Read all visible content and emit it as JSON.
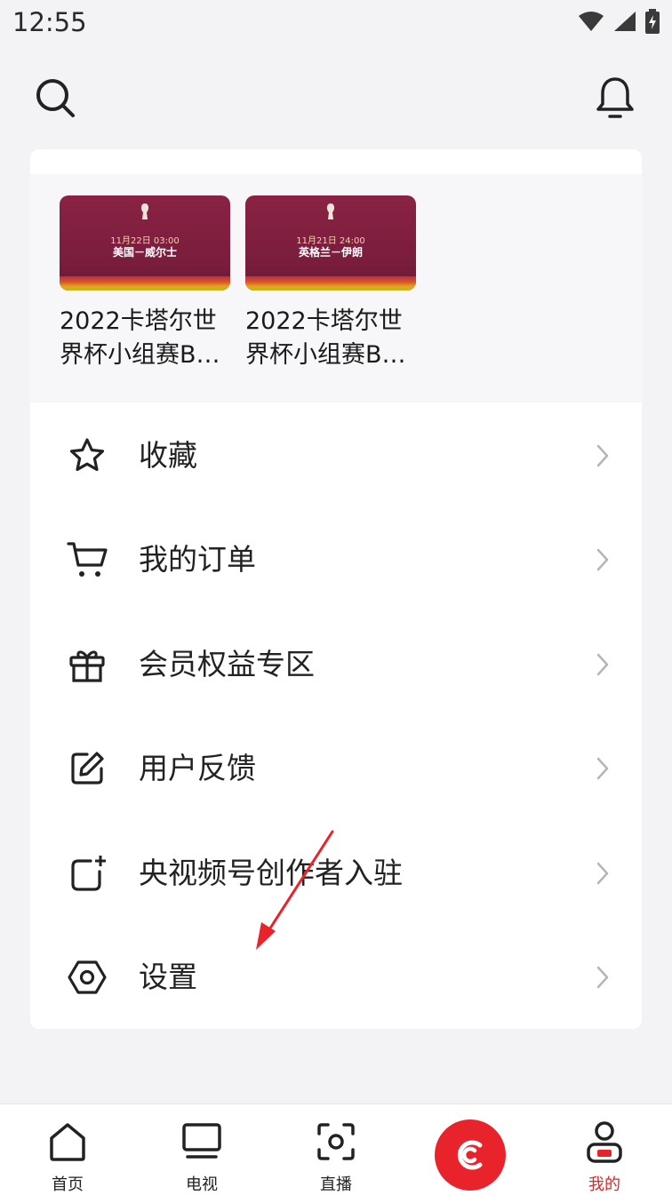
{
  "status_bar": {
    "time": "12:55",
    "icons": [
      "wifi-icon",
      "cellular-signal-icon",
      "battery-charging-icon"
    ]
  },
  "header": {
    "icons": [
      "search-icon",
      "bell-icon"
    ]
  },
  "history": [
    {
      "title": "2022卡塔尔世界杯小组赛B组",
      "display_title": "2022卡塔尔世界杯小组赛B…",
      "date_text": "11月22日 03:00",
      "match_text": "美国－威尔士"
    },
    {
      "title": "2022卡塔尔世界杯小组赛B组",
      "display_title": "2022卡塔尔世界杯小组赛B…",
      "date_text": "11月21日 24:00",
      "match_text": "英格兰－伊朗"
    }
  ],
  "menu": [
    {
      "label": "收藏",
      "icon": "star-icon"
    },
    {
      "label": "我的订单",
      "icon": "cart-icon"
    },
    {
      "label": "会员权益专区",
      "icon": "gift-icon"
    },
    {
      "label": "用户反馈",
      "icon": "edit-icon"
    },
    {
      "label": "央视频号创作者入驻",
      "icon": "add-square-icon"
    },
    {
      "label": "设置",
      "icon": "settings-hexagon-icon"
    }
  ],
  "tabs": [
    {
      "label": "首页",
      "icon": "home-icon",
      "active": false
    },
    {
      "label": "电视",
      "icon": "tv-icon",
      "active": false
    },
    {
      "label": "直播",
      "icon": "live-icon",
      "active": false
    },
    {
      "label": "",
      "icon": "cctv-logo-icon",
      "active": false
    },
    {
      "label": "我的",
      "icon": "profile-icon",
      "active": true
    }
  ],
  "colors": {
    "accent": "#e8232b",
    "active_tab": "#e32424",
    "background": "#f3f3f5",
    "card": "#ffffff"
  }
}
